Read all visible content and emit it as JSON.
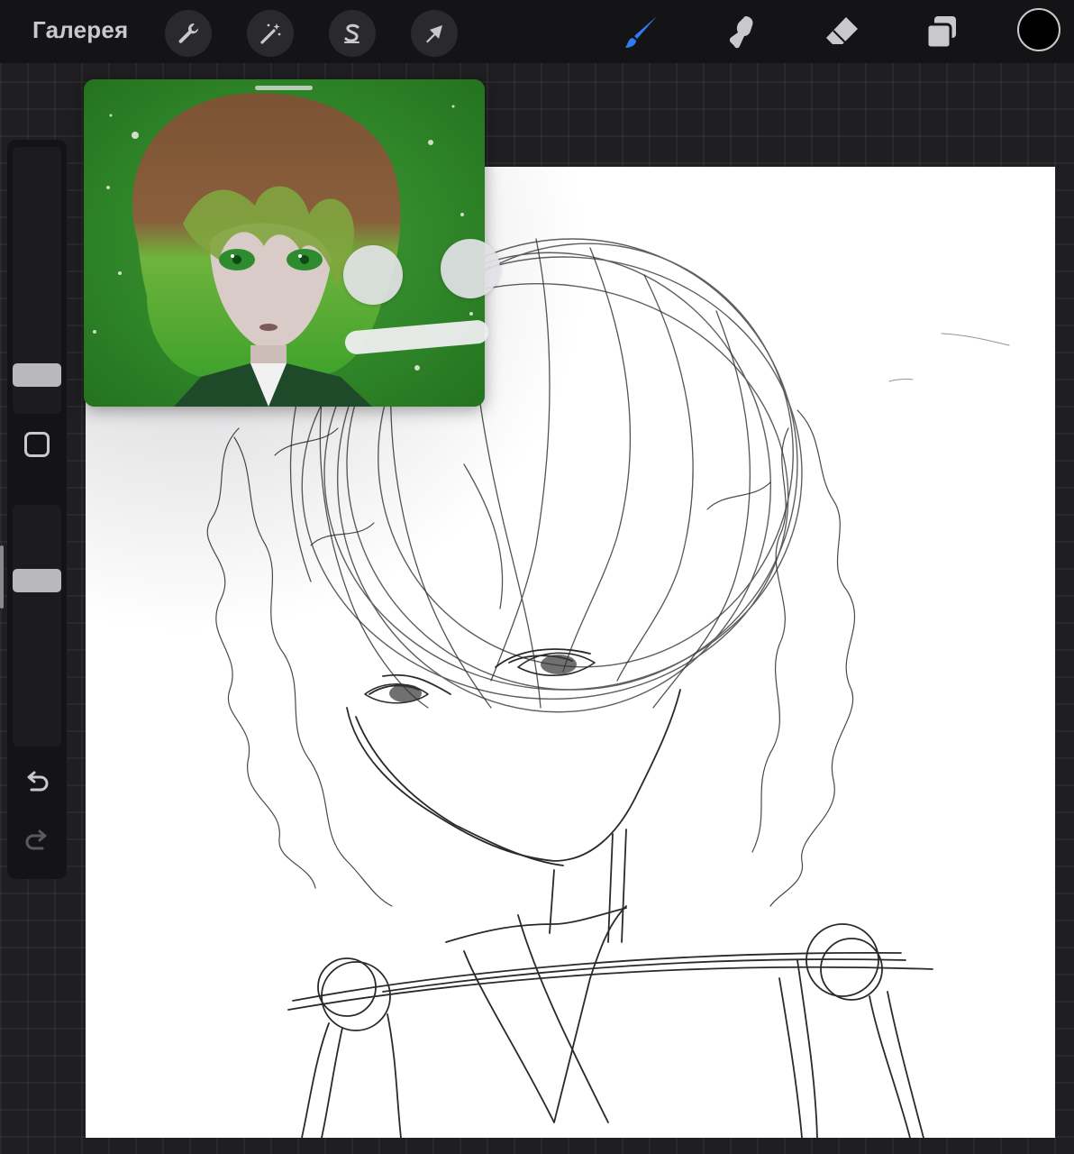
{
  "toolbar": {
    "gallery_label": "Галерея",
    "left_tools": [
      {
        "name": "actions",
        "icon": "wrench-icon"
      },
      {
        "name": "adjustments",
        "icon": "magic-wand-icon"
      },
      {
        "name": "selection",
        "icon": "selection-s-icon"
      },
      {
        "name": "transform",
        "icon": "arrow-cursor-icon"
      }
    ],
    "right_tools": [
      {
        "name": "brush",
        "icon": "brush-icon",
        "active": true
      },
      {
        "name": "smudge",
        "icon": "smudge-icon",
        "active": false
      },
      {
        "name": "eraser",
        "icon": "eraser-icon",
        "active": false
      },
      {
        "name": "layers",
        "icon": "layers-icon",
        "active": false
      }
    ],
    "current_color": "#000000"
  },
  "sidebar": {
    "brush_size_icon": "slider-handle",
    "modify_icon": "square-outline-icon",
    "opacity_icon": "slider-handle",
    "undo_icon": "undo-arrow-icon",
    "redo_icon": "redo-arrow-icon"
  },
  "colors": {
    "accent_active": "#2f7cf6",
    "toolbar_bg": "#141416",
    "workspace_bg": "#1f1f22",
    "icon": "#c9c9cc",
    "reference_green": "#2f8a2a"
  }
}
